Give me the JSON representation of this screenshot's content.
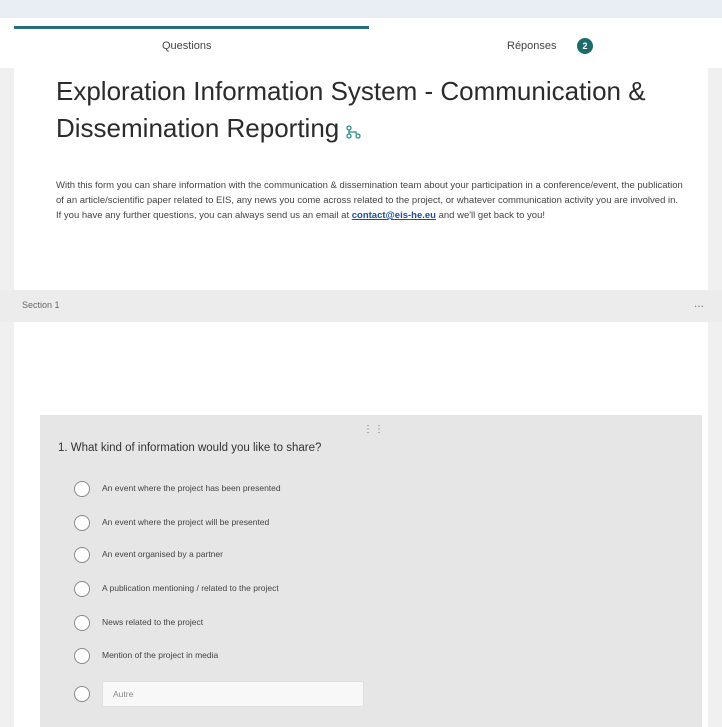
{
  "tabs": {
    "questions": "Questions",
    "responses": "Réponses",
    "responses_count": "2"
  },
  "form": {
    "title": "Exploration Information System - Communication & Dissemination Reporting",
    "description_before_link": "With this form you can share information with the communication & dissemination team about your participation in a conference/event, the publication of an article/scientific paper related to EIS, any news you come across related to the project, or whatever communication activity you are involved in. If you have any further questions, you can always send us an email at ",
    "email": "contact@eis-he.eu",
    "description_after_link": " and we'll get back to you!"
  },
  "section": {
    "label": "Section 1",
    "menu": "..."
  },
  "question": {
    "drag_handle": "⋮⋮",
    "title": "1. What kind of information would you like to share?",
    "options": [
      "An event where the project has been presented",
      "An event where the project will be presented",
      "An event organised by a partner",
      "A publication mentioning / related to the project",
      "News related to the project",
      "Mention of the project in media"
    ],
    "other_placeholder": "Autre"
  },
  "colors": {
    "accent": "#2a6f74",
    "badge": "#1e6b6b",
    "link": "#1c4fa0"
  }
}
